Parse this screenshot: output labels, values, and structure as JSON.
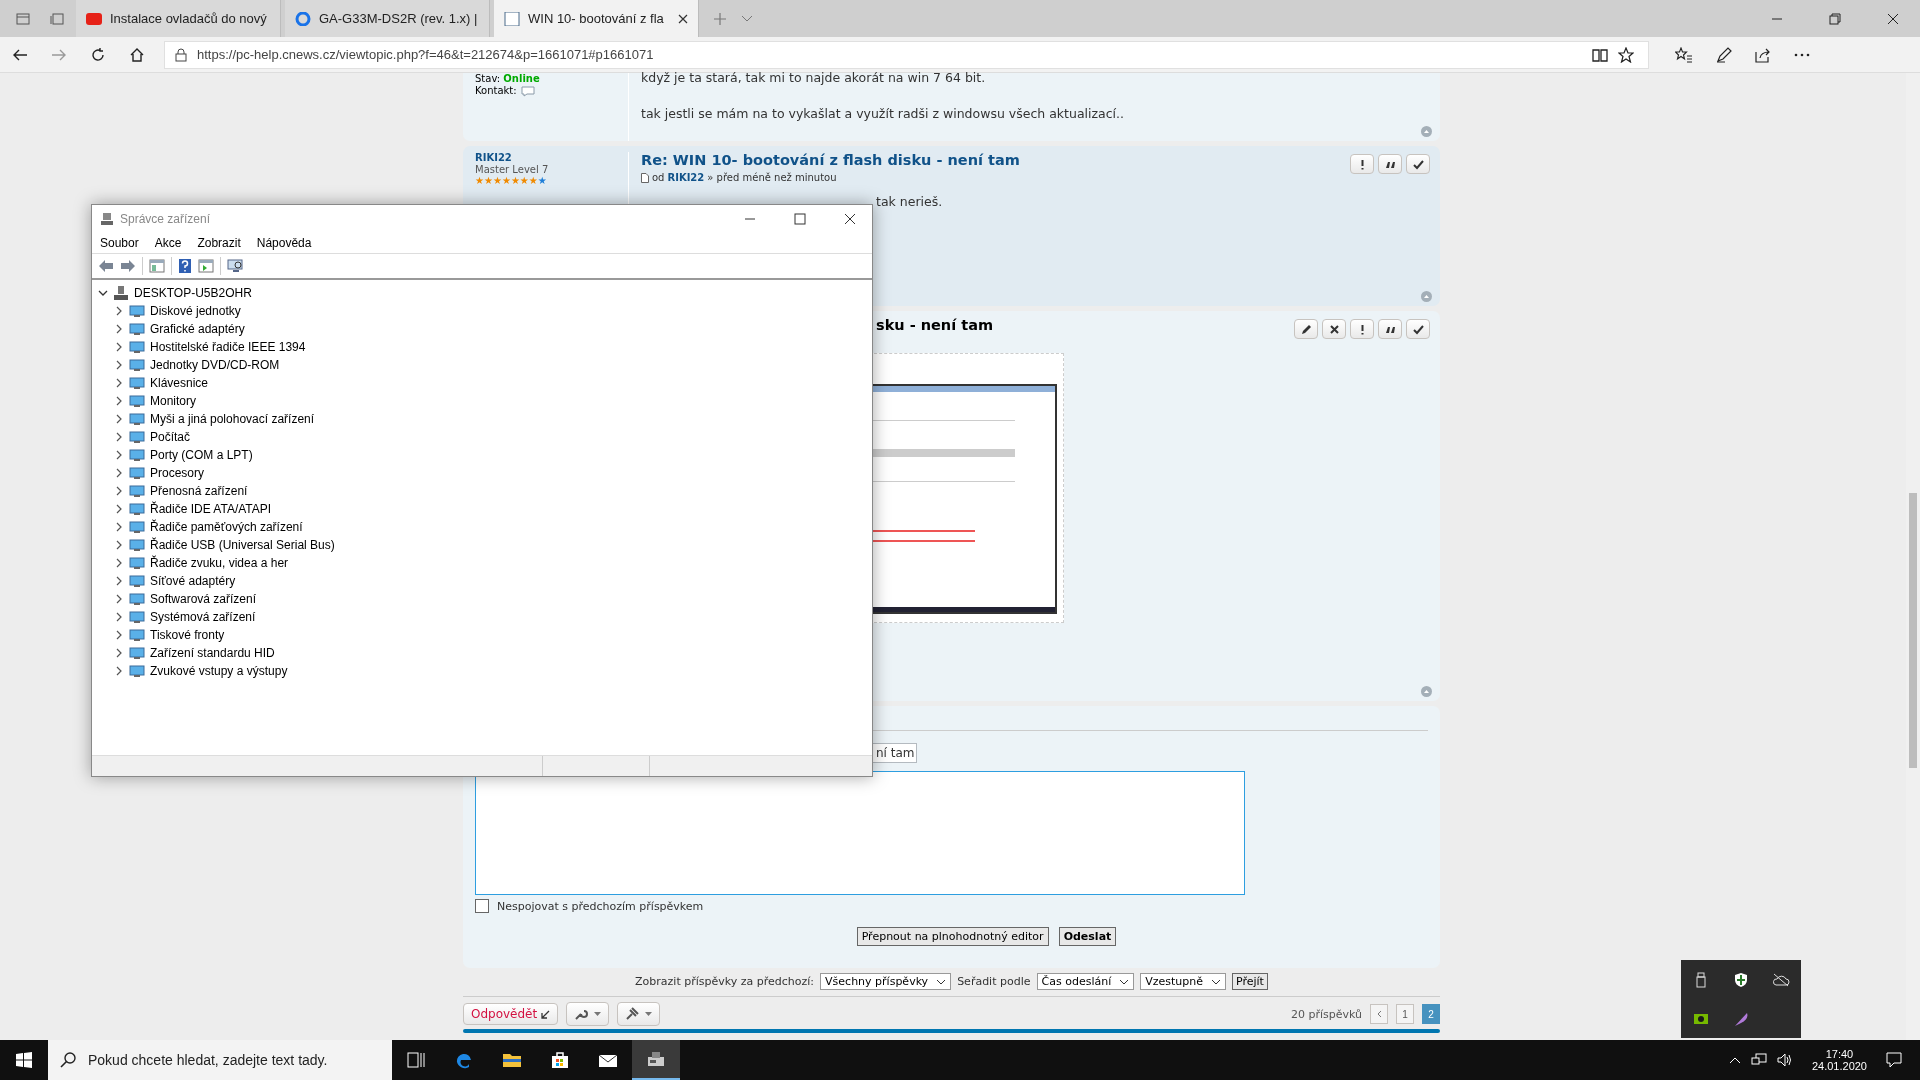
{
  "browser": {
    "tabs": [
      {
        "kind": "video",
        "title": "Instalace ovladačů do nový",
        "selected": false
      },
      {
        "kind": "search",
        "title": "GA-G33M-DS2R (rev. 1.x) |",
        "selected": false
      },
      {
        "kind": "page",
        "title": "WIN 10- bootování z fla",
        "selected": true
      }
    ],
    "url": "https://pc-help.cnews.cz/viewtopic.php?f=46&t=212674&p=1661071#p1661071"
  },
  "post_top": {
    "status_label": "Stav:",
    "status": "Online",
    "contact_label": "Kontakt:",
    "lines": [
      "když je ta stará, tak mi to najde akorát na win 7 64 bit.",
      "tak jestli se mám na to vykašlat a využít radši z windowsu všech aktualizací.."
    ]
  },
  "post_reply": {
    "author": "RIKI22",
    "rank": "Master Level 7",
    "stars": 7,
    "title": "Re: WIN 10- bootování z flash disku - není tam",
    "by_prefix": "od",
    "by_author": "RIKI22",
    "time": "» před méně než minutou",
    "text": "tak nerieš.",
    "actions": [
      {
        "kind": "report"
      },
      {
        "kind": "quote"
      },
      {
        "kind": "approve"
      }
    ]
  },
  "post_attachment": {
    "title": "sku - není tam",
    "actions": [
      {
        "kind": "edit"
      },
      {
        "kind": "delete"
      },
      {
        "kind": "report"
      },
      {
        "kind": "quote"
      },
      {
        "kind": "approve"
      }
    ]
  },
  "reply_form": {
    "subject": "ní tam",
    "no_merge": {
      "label": "Nespojovat s předchozím příspěvkem",
      "checked": false
    },
    "buttons": [
      {
        "kind": "plain",
        "label": "Přepnout na plnohodnotný editor"
      },
      {
        "kind": "primary",
        "label": "Odeslat"
      }
    ]
  },
  "filter": {
    "label": "Zobrazit příspěvky za předchozí:",
    "period": "Všechny příspěvky",
    "sort_label": "Seřadit podle",
    "sort": "Čas odeslání",
    "order": "Vzestupně",
    "go": "Přejít"
  },
  "pagination": {
    "reply": "Odpovědět",
    "count": "20 příspěvků",
    "pages": [
      {
        "label": "1",
        "selected": false
      },
      {
        "label": "2",
        "selected": true
      }
    ]
  },
  "window": {
    "title": "Správce zařízení",
    "menu": [
      "Soubor",
      "Akce",
      "Zobrazit",
      "Nápověda"
    ],
    "tree": {
      "label": "DESKTOP-U5B2OHR",
      "expanded": true,
      "children": [
        {
          "label": "Diskové jednotky",
          "expanded": false
        },
        {
          "label": "Grafické adaptéry",
          "expanded": false
        },
        {
          "label": "Hostitelské řadiče IEEE 1394",
          "expanded": false
        },
        {
          "label": "Jednotky DVD/CD-ROM",
          "expanded": false
        },
        {
          "label": "Klávesnice",
          "expanded": false
        },
        {
          "label": "Monitory",
          "expanded": false
        },
        {
          "label": "Myši a jiná polohovací zařízení",
          "expanded": false
        },
        {
          "label": "Počítač",
          "expanded": false
        },
        {
          "label": "Porty (COM a LPT)",
          "expanded": false
        },
        {
          "label": "Procesory",
          "expanded": false
        },
        {
          "label": "Přenosná zařízení",
          "expanded": false
        },
        {
          "label": "Řadiče IDE ATA/ATAPI",
          "expanded": false
        },
        {
          "label": "Řadiče paměťových zařízení",
          "expanded": false
        },
        {
          "label": "Řadiče USB (Universal Serial Bus)",
          "expanded": false
        },
        {
          "label": "Řadiče zvuku, videa a her",
          "expanded": false
        },
        {
          "label": "Síťové adaptéry",
          "expanded": false
        },
        {
          "label": "Softwarová zařízení",
          "expanded": false
        },
        {
          "label": "Systémová zařízení",
          "expanded": false
        },
        {
          "label": "Tiskové fronty",
          "expanded": false
        },
        {
          "label": "Zařízení standardu HID",
          "expanded": false
        },
        {
          "label": "Zvukové vstupy a výstupy",
          "expanded": false
        }
      ]
    }
  },
  "taskbar": {
    "search_placeholder": "Pokud chcete hledat, zadejte text tady.",
    "apps": [
      {
        "kind": "taskview",
        "active": false
      },
      {
        "kind": "edge",
        "active": false
      },
      {
        "kind": "folder",
        "active": false
      },
      {
        "kind": "store",
        "active": false
      },
      {
        "kind": "mail",
        "active": false
      },
      {
        "kind": "devices",
        "active": true
      }
    ],
    "time": "17:40",
    "date": "24.01.2020"
  }
}
